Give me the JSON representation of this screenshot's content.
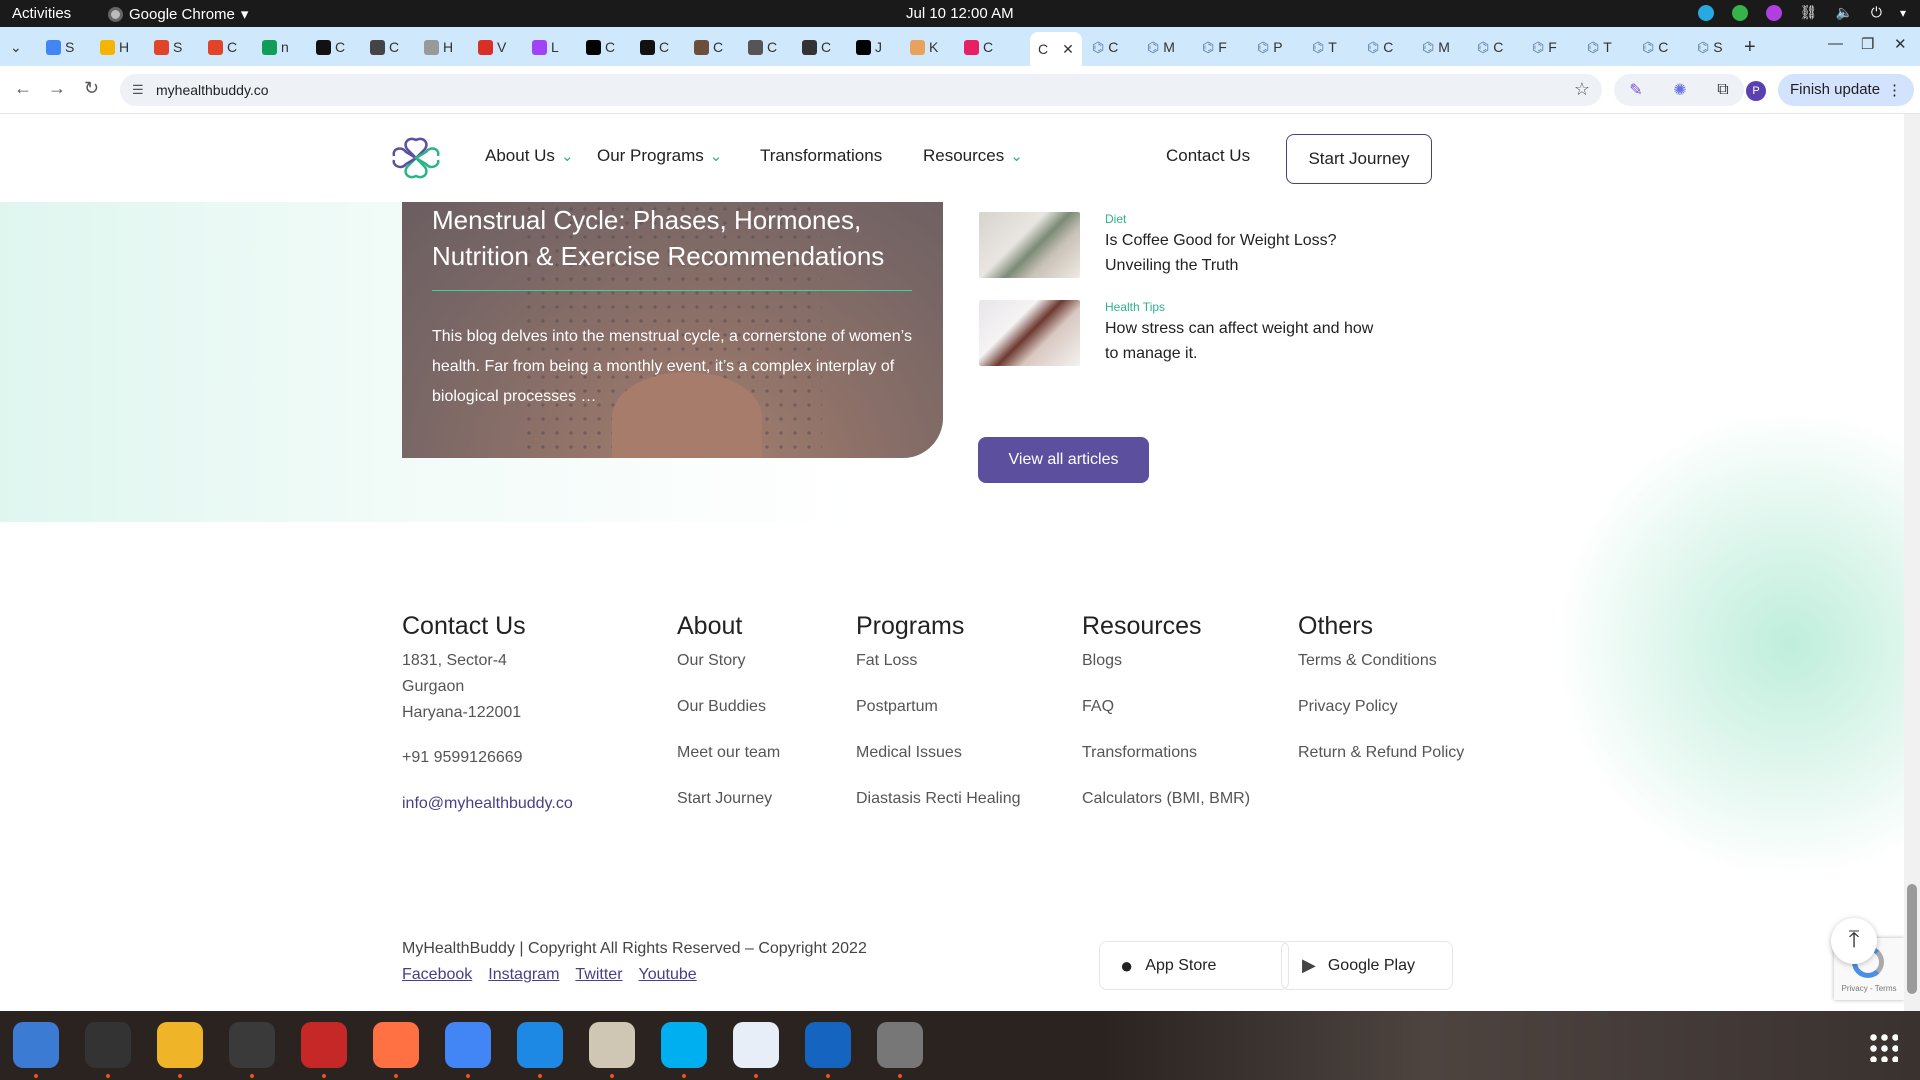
{
  "system_bar": {
    "activities": "Activities",
    "app_name": "Google Chrome",
    "clock": "Jul 10  12:00 AM"
  },
  "browser": {
    "tabs": [
      {
        "label": "S",
        "color": "#4285f4"
      },
      {
        "label": "H",
        "color": "#f4b400"
      },
      {
        "label": "S",
        "color": "#e24329"
      },
      {
        "label": "C",
        "color": "#e24329"
      },
      {
        "label": "n",
        "color": "#0f9d58"
      },
      {
        "label": "C",
        "color": "#111111"
      },
      {
        "label": "C",
        "color": "#444444"
      },
      {
        "label": "H",
        "color": "#999999"
      },
      {
        "label": "V",
        "color": "#d93025"
      },
      {
        "label": "L",
        "color": "#a142f4"
      },
      {
        "label": "C",
        "color": "#000000"
      },
      {
        "label": "C",
        "color": "#111111"
      },
      {
        "label": "C",
        "color": "#6b4f3a"
      },
      {
        "label": "C",
        "color": "#555555"
      },
      {
        "label": "C",
        "color": "#333333"
      },
      {
        "label": "J",
        "color": "#000000"
      },
      {
        "label": "K",
        "color": "#e8a25b"
      },
      {
        "label": "C",
        "color": "#e91e63"
      }
    ],
    "active_tab_label": "C",
    "inactive_tabs_right": [
      "C",
      "M",
      "F",
      "P",
      "T",
      "C",
      "M",
      "C",
      "F",
      "T",
      "C",
      "S"
    ],
    "url": "myhealthbuddy.co",
    "profile_initial": "P",
    "finish_update": "Finish update"
  },
  "site": {
    "nav": {
      "about": "About Us",
      "programs": "Our Programs",
      "transformations": "Transformations",
      "resources": "Resources",
      "contact": "Contact Us",
      "start": "Start Journey"
    },
    "featured": {
      "title": "Menstrual Cycle: Phases, Hormones, Nutrition & Exercise Recommendations",
      "description": "This blog delves into the menstrual cycle, a cornerstone of women’s health. Far from being a monthly event, it’s a complex interplay of biological processes …"
    },
    "articles": [
      {
        "category": "Diet",
        "title": "Is Coffee Good for Weight Loss? Unveiling the Truth"
      },
      {
        "category": "Health Tips",
        "title": "How stress can affect weight and how to manage it."
      }
    ],
    "view_all": "View all articles",
    "footer": {
      "contact": {
        "heading": "Contact Us",
        "address1": "1831, Sector-4",
        "address2": "Gurgaon",
        "address3": "Haryana-122001",
        "phone": "+91 9599126669",
        "email": "info@myhealthbuddy.co"
      },
      "about": {
        "heading": "About",
        "links": [
          "Our Story",
          "Our Buddies",
          "Meet our team",
          "Start Journey"
        ]
      },
      "programs": {
        "heading": "Programs",
        "links": [
          "Fat Loss",
          "Postpartum",
          "Medical Issues",
          "Diastasis Recti Healing"
        ]
      },
      "resources": {
        "heading": "Resources",
        "links": [
          "Blogs",
          "FAQ",
          "Transformations",
          "Calculators (BMI, BMR)"
        ]
      },
      "others": {
        "heading": "Others",
        "links": [
          "Terms & Conditions",
          "Privacy Policy",
          "Return & Refund Policy"
        ]
      },
      "copyright": "MyHealthBuddy | Copyright All Rights Reserved – Copyright 2022",
      "social": [
        "Facebook",
        "Instagram",
        "Twitter",
        "Youtube"
      ],
      "app_store": "App Store",
      "google_play": "Google Play"
    },
    "recaptcha": "Privacy - Terms"
  },
  "colors": {
    "brand_purple": "#5c4f9e",
    "brand_green": "#2bb38a",
    "chrome_tab_strip": "#cfe8fb"
  },
  "dock_apps": [
    "thunderbird",
    "terminal",
    "calculator",
    "system-monitor",
    "filezilla",
    "firefox",
    "chrome",
    "vscode",
    "files",
    "skype",
    "text-editor",
    "libreoffice-writer",
    "disk-utility",
    "show-apps"
  ]
}
